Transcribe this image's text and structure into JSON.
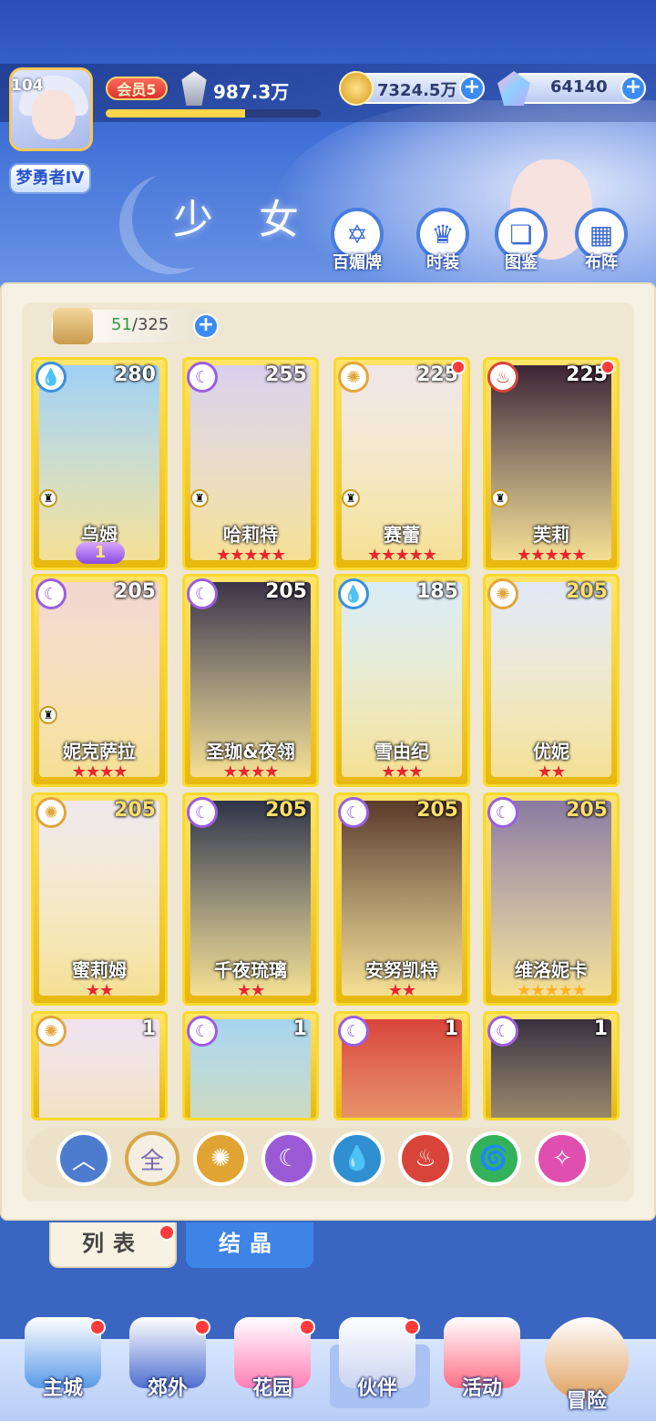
{
  "header": {
    "player_level": "104",
    "player_rank": "梦勇者IV",
    "vip_label": "会员5",
    "power_value": "987.3万",
    "exp_progress": 0.65,
    "gold_value": "7324.5万",
    "gem_value": "64140",
    "plus_symbol": "+"
  },
  "page_title": "少 女",
  "top_menu": [
    {
      "label": "百媚牌",
      "icon": "card-icon"
    },
    {
      "label": "时装",
      "icon": "dress-icon"
    },
    {
      "label": "图鉴",
      "icon": "book-icon"
    },
    {
      "label": "布阵",
      "icon": "grid-icon"
    }
  ],
  "capacity": {
    "current": "51",
    "total": "/325"
  },
  "cards": [
    {
      "name": "乌姆",
      "level": "280",
      "element": "water",
      "stars": "",
      "badge": "1",
      "dot": false,
      "chess": true,
      "gold_level": false
    },
    {
      "name": "哈莉特",
      "level": "255",
      "element": "moon",
      "stars": "★★★★★",
      "badge": "",
      "dot": false,
      "chess": true,
      "gold_level": false
    },
    {
      "name": "赛蕾",
      "level": "225",
      "element": "sun",
      "stars": "★★★★★",
      "badge": "",
      "dot": true,
      "chess": true,
      "gold_level": false
    },
    {
      "name": "芙莉",
      "level": "225",
      "element": "fire",
      "stars": "★★★★★",
      "badge": "",
      "dot": true,
      "chess": true,
      "gold_level": false
    },
    {
      "name": "妮克萨拉",
      "level": "205",
      "element": "moon",
      "stars": "★★★★",
      "badge": "",
      "dot": false,
      "chess": true,
      "gold_level": false
    },
    {
      "name": "圣珈&夜翎",
      "level": "205",
      "element": "moon",
      "stars": "★★★★",
      "badge": "",
      "dot": false,
      "chess": false,
      "gold_level": false
    },
    {
      "name": "雪由纪",
      "level": "185",
      "element": "water",
      "stars": "★★★",
      "badge": "",
      "dot": false,
      "chess": false,
      "gold_level": false
    },
    {
      "name": "优妮",
      "level": "205",
      "element": "sun",
      "stars": "★★",
      "badge": "",
      "dot": false,
      "chess": false,
      "gold_level": true
    },
    {
      "name": "蜜莉姆",
      "level": "205",
      "element": "sun",
      "stars": "★★",
      "badge": "",
      "dot": false,
      "chess": false,
      "gold_level": true
    },
    {
      "name": "千夜琉璃",
      "level": "205",
      "element": "moon",
      "stars": "★★",
      "badge": "",
      "dot": false,
      "chess": false,
      "gold_level": true
    },
    {
      "name": "安努凯特",
      "level": "205",
      "element": "moon",
      "stars": "★★",
      "badge": "",
      "dot": false,
      "chess": false,
      "gold_level": true
    },
    {
      "name": "维洛妮卡",
      "level": "205",
      "element": "moon",
      "stars": "★★★★★",
      "badge": "",
      "dot": false,
      "chess": false,
      "gold_level": true,
      "gold_stars": true
    },
    {
      "name": "",
      "level": "1",
      "element": "sun",
      "stars": "",
      "badge": "",
      "dot": false,
      "chess": false,
      "gold_level": false
    },
    {
      "name": "",
      "level": "1",
      "element": "moon",
      "stars": "",
      "badge": "",
      "dot": false,
      "chess": false,
      "gold_level": false
    },
    {
      "name": "",
      "level": "1",
      "element": "moon",
      "stars": "",
      "badge": "",
      "dot": false,
      "chess": false,
      "gold_level": false
    },
    {
      "name": "",
      "level": "1",
      "element": "moon",
      "stars": "",
      "badge": "",
      "dot": false,
      "chess": false,
      "gold_level": false
    }
  ],
  "filters": [
    {
      "name": "sort",
      "glyph": "︿",
      "color": "#4d7ccf"
    },
    {
      "name": "all",
      "glyph": "全",
      "color": "#f4efe2"
    },
    {
      "name": "sun",
      "glyph": "✺",
      "color": "#e0a432"
    },
    {
      "name": "moon",
      "glyph": "☾",
      "color": "#9a5ad6"
    },
    {
      "name": "water",
      "glyph": "💧",
      "color": "#2f8fd0"
    },
    {
      "name": "fire",
      "glyph": "♨",
      "color": "#d8443a"
    },
    {
      "name": "wind",
      "glyph": "🌀",
      "color": "#34b25a"
    },
    {
      "name": "star",
      "glyph": "✧",
      "color": "#e04fb0"
    }
  ],
  "tabs": {
    "list": "列表",
    "crystal": "结晶"
  },
  "nav": [
    {
      "label": "主城",
      "dot": true
    },
    {
      "label": "郊外",
      "dot": true
    },
    {
      "label": "花园",
      "dot": true
    },
    {
      "label": "伙伴",
      "dot": true
    },
    {
      "label": "活动",
      "dot": false
    },
    {
      "label": "冒险",
      "dot": false
    }
  ],
  "element_colors": {
    "water": "#3a8fe0",
    "moon": "#9b5ee0",
    "sun": "#e2a53a",
    "fire": "#d8443a"
  },
  "element_glyphs": {
    "water": "💧",
    "moon": "☾",
    "sun": "✺",
    "fire": "♨"
  }
}
